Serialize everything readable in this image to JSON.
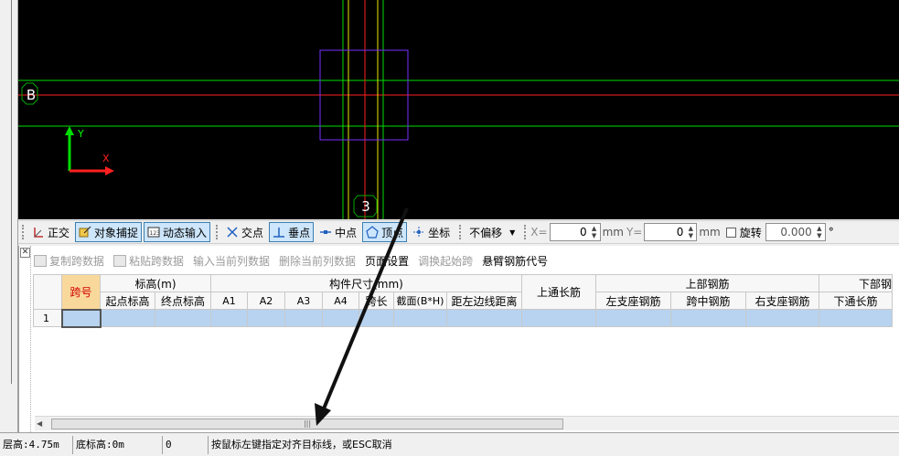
{
  "canvas": {
    "background": "#000000",
    "axis_b_label": "B",
    "axis_3_label": "3",
    "y_axis_label": "Y",
    "x_axis_label": "X",
    "colors": {
      "green_line": "#00dd00",
      "red_line": "#ff2020",
      "yellow_line": "#e8e800",
      "purple_rect": "#7a30ff",
      "axis_circle": "#00aa00"
    }
  },
  "snap_toolbar": {
    "ortho": "正交",
    "object_snap": "对象捕捉",
    "dynamic_input": "动态输入",
    "intersection": "交点",
    "perpendicular": "垂点",
    "midpoint": "中点",
    "vertex": "顶点",
    "coordinate": "坐标",
    "offset_select": "不偏移",
    "x_label": "X=",
    "x_value": "0",
    "x_unit": "mm",
    "y_label": "Y=",
    "y_value": "0",
    "y_unit": "mm",
    "rotate_label": "旋转",
    "rotate_value": "0.000",
    "degree_symbol": "°"
  },
  "table_toolbar": {
    "copy_span": "复制跨数据",
    "paste_span": "粘贴跨数据",
    "input_current_col": "输入当前列数据",
    "delete_current_col": "删除当前列数据",
    "page_setup": "页面设置",
    "swap_start_span": "调换起始跨",
    "cantilever_code": "悬臂钢筋代号"
  },
  "grid": {
    "span_no": "跨号",
    "elevation_group": "标高(m)",
    "start_elev": "起点标高",
    "end_elev": "终点标高",
    "dimension_group": "构件尺寸(mm)",
    "a1": "A1",
    "a2": "A2",
    "a3": "A3",
    "a4": "A4",
    "span_length": "跨长",
    "section": "截面(B*H)",
    "left_edge_dist": "距左边线距离",
    "top_through_rebar": "上通长筋",
    "top_rebar_group": "上部钢筋",
    "left_support_rebar": "左支座钢筋",
    "mid_span_rebar": "跨中钢筋",
    "right_support_rebar": "右支座钢筋",
    "bottom_rebar_group": "下部钢",
    "bottom_through_rebar": "下通长筋",
    "rows": [
      {
        "num": "1"
      }
    ]
  },
  "statusbar": {
    "floor_height": "层高:4.75m",
    "base_elev": "底标高:0m",
    "value": "0",
    "prompt": "按鼠标左键指定对齐目标线，或ESC取消"
  }
}
